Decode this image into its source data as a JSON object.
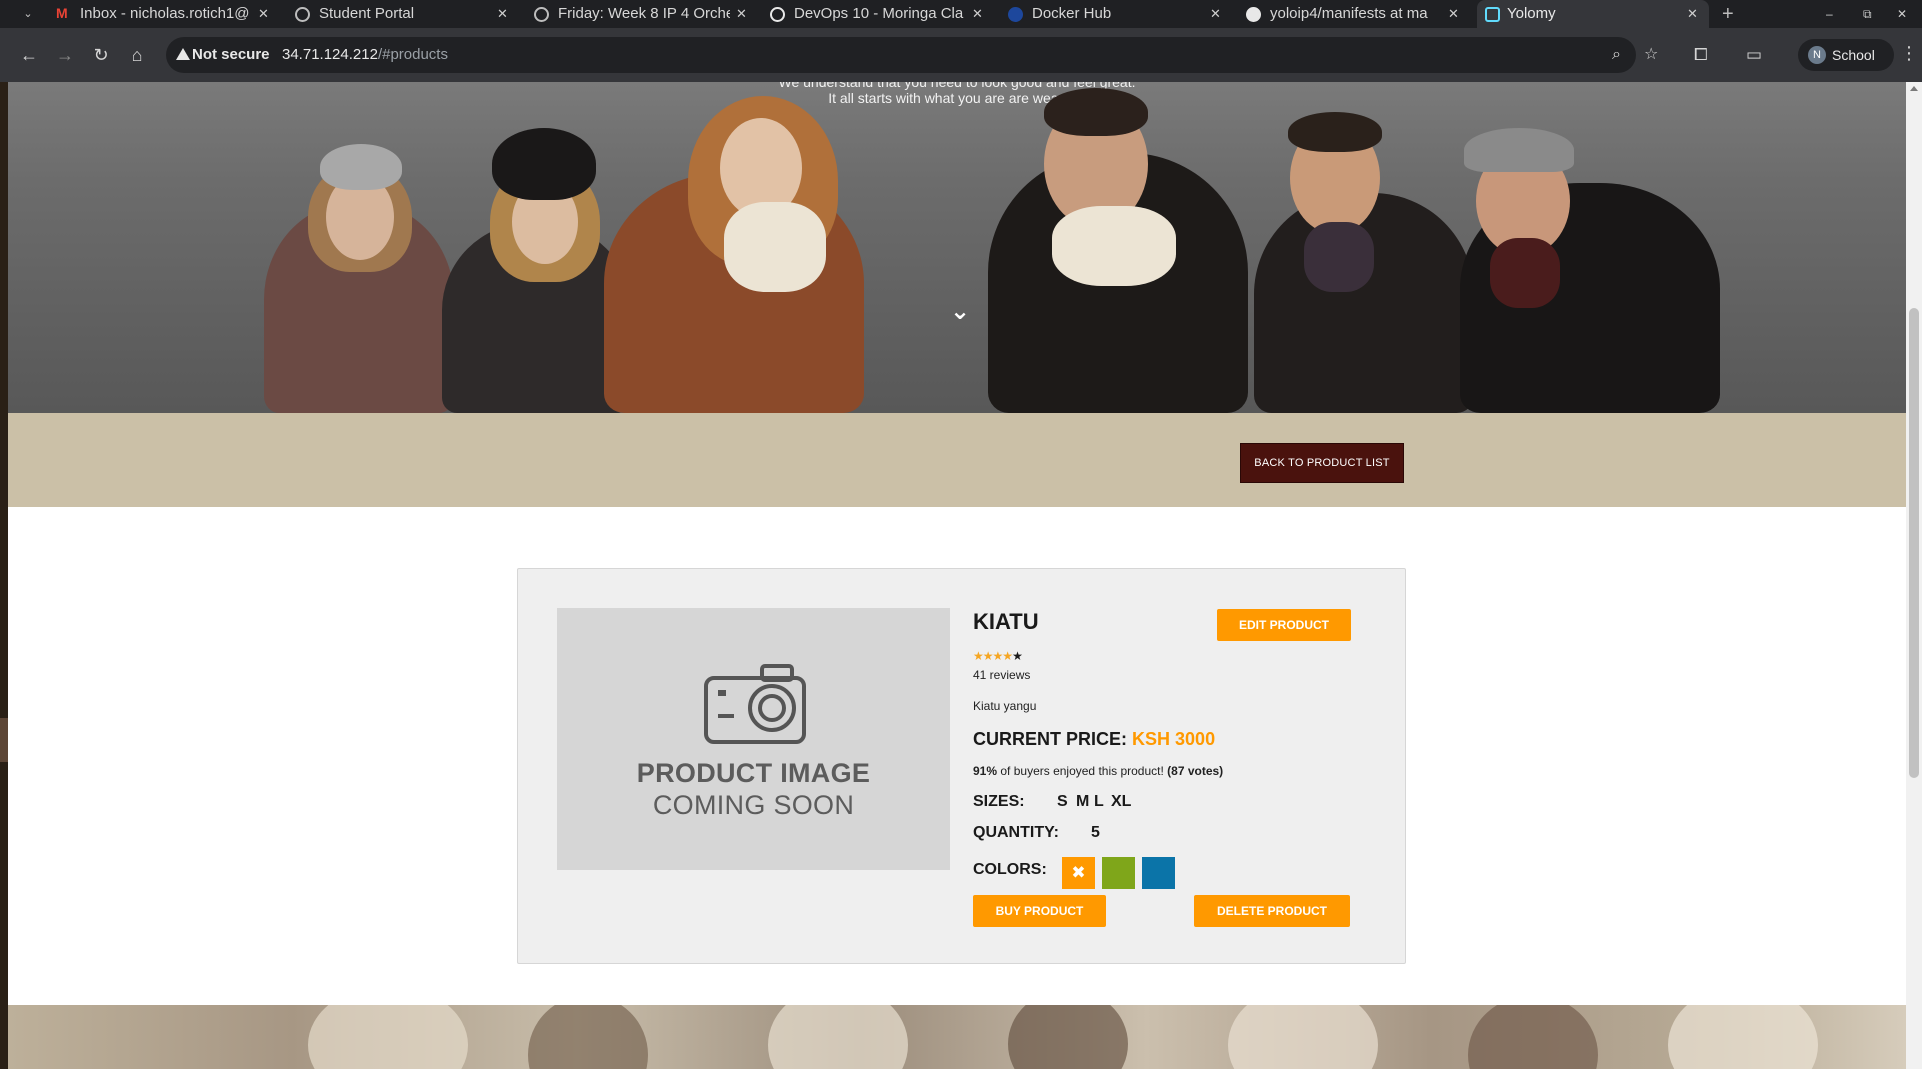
{
  "browser": {
    "tabs": [
      {
        "title": "Inbox - nicholas.rotich1@",
        "icon": "gmail-icon"
      },
      {
        "title": "Student Portal",
        "icon": "globe-icon"
      },
      {
        "title": "Friday: Week 8 IP 4 Orche",
        "icon": "globe-icon"
      },
      {
        "title": "DevOps 10 - Moringa Cla",
        "icon": "moringa-icon"
      },
      {
        "title": "Docker Hub",
        "icon": "docker-icon"
      },
      {
        "title": "yoloip4/manifests at ma",
        "icon": "github-icon"
      },
      {
        "title": "Yolomy",
        "icon": "yolomy-icon",
        "active": true
      }
    ],
    "omnibox": {
      "security_label": "Not secure",
      "host": "34.71.124.212",
      "path": "/#products"
    },
    "profile_name": "School",
    "profile_initial": "N"
  },
  "hero": {
    "tagline_cut": "We understand that you need to look good and feel great.",
    "tagline": "It all starts with what you are are wearing."
  },
  "band": {
    "back_button": "BACK TO PRODUCT LIST"
  },
  "product": {
    "image_placeholder_line1": "PRODUCT IMAGE",
    "image_placeholder_line2": "COMING SOON",
    "name": "KIATU",
    "edit_button": "EDIT PRODUCT",
    "rating": 4,
    "rating_max": 5,
    "reviews": "41 reviews",
    "description": "Kiatu yangu",
    "price_label": "CURRENT PRICE:",
    "price_value": "KSH 3000",
    "enjoy_percent": "91%",
    "enjoy_text": "of buyers enjoyed this product!",
    "enjoy_votes": "(87 votes)",
    "sizes_label": "SIZES:",
    "sizes": [
      "S",
      "M",
      "L",
      "XL"
    ],
    "quantity_label": "QUANTITY:",
    "quantity": "5",
    "colors_label": "COLORS:",
    "colors": [
      "#ff9900",
      "#7fa61a",
      "#0b74a8"
    ],
    "selected_color_mark": "✖",
    "buy_button": "BUY PRODUCT",
    "delete_button": "DELETE PRODUCT"
  }
}
